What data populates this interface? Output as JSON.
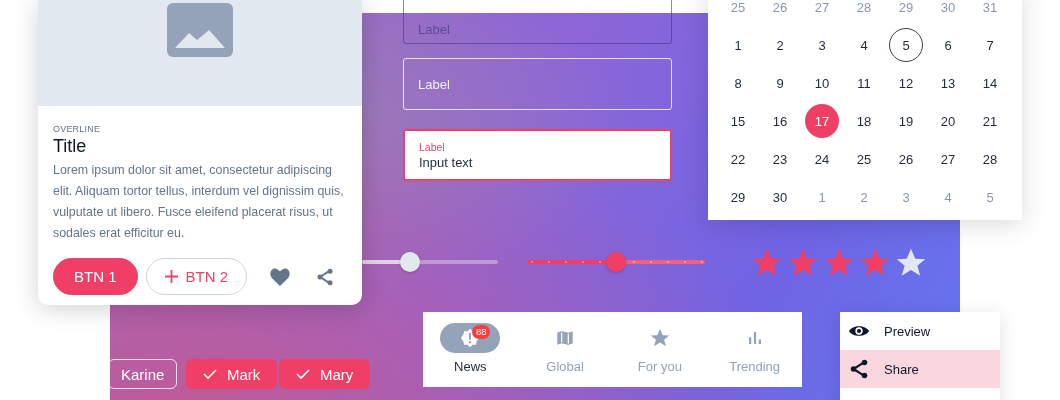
{
  "card": {
    "overline": "OVERLINE",
    "title": "Title",
    "body": "Lorem ipsum dolor sit amet, consectetur adipiscing elit. Aliquam tortor tellus, interdum vel dignissim quis, vulputate ut libero. Fusce eleifend placerat risus, ut sodales erat efficitur eu.",
    "buttons": [
      {
        "label": "BTN 1",
        "kind": "filled"
      },
      {
        "label": "BTN 2",
        "kind": "outlined"
      }
    ]
  },
  "text_fields": [
    {
      "kind": "dim",
      "label": "Label"
    },
    {
      "kind": "outlined",
      "label": "Label"
    },
    {
      "kind": "active",
      "label": "Label",
      "value": "Input text"
    }
  ],
  "calendar": {
    "days": [
      {
        "label": "25",
        "kind": "outside",
        "selected": false,
        "today": false
      },
      {
        "label": "26",
        "kind": "outside",
        "selected": false,
        "today": false
      },
      {
        "label": "27",
        "kind": "outside",
        "selected": false,
        "today": false
      },
      {
        "label": "28",
        "kind": "outside",
        "selected": false,
        "today": false
      },
      {
        "label": "29",
        "kind": "outside",
        "selected": false,
        "today": false
      },
      {
        "label": "30",
        "kind": "outside",
        "selected": false,
        "today": false
      },
      {
        "label": "31",
        "kind": "outside",
        "selected": false,
        "today": false
      },
      {
        "label": "1",
        "kind": "day",
        "selected": false,
        "today": false
      },
      {
        "label": "2",
        "kind": "day",
        "selected": false,
        "today": false
      },
      {
        "label": "3",
        "kind": "day",
        "selected": false,
        "today": false
      },
      {
        "label": "4",
        "kind": "day",
        "selected": false,
        "today": false
      },
      {
        "label": "5",
        "kind": "day",
        "selected": false,
        "today": true
      },
      {
        "label": "6",
        "kind": "day",
        "selected": false,
        "today": false
      },
      {
        "label": "7",
        "kind": "day",
        "selected": false,
        "today": false
      },
      {
        "label": "8",
        "kind": "day",
        "selected": false,
        "today": false
      },
      {
        "label": "9",
        "kind": "day",
        "selected": false,
        "today": false
      },
      {
        "label": "10",
        "kind": "day",
        "selected": false,
        "today": false
      },
      {
        "label": "11",
        "kind": "day",
        "selected": false,
        "today": false
      },
      {
        "label": "12",
        "kind": "day",
        "selected": false,
        "today": false
      },
      {
        "label": "13",
        "kind": "day",
        "selected": false,
        "today": false
      },
      {
        "label": "14",
        "kind": "day",
        "selected": false,
        "today": false
      },
      {
        "label": "15",
        "kind": "day",
        "selected": false,
        "today": false
      },
      {
        "label": "16",
        "kind": "day",
        "selected": false,
        "today": false
      },
      {
        "label": "17",
        "kind": "day",
        "selected": true,
        "today": false
      },
      {
        "label": "18",
        "kind": "day",
        "selected": false,
        "today": false
      },
      {
        "label": "19",
        "kind": "day",
        "selected": false,
        "today": false
      },
      {
        "label": "20",
        "kind": "day",
        "selected": false,
        "today": false
      },
      {
        "label": "21",
        "kind": "day",
        "selected": false,
        "today": false
      },
      {
        "label": "22",
        "kind": "day",
        "selected": false,
        "today": false
      },
      {
        "label": "23",
        "kind": "day",
        "selected": false,
        "today": false
      },
      {
        "label": "24",
        "kind": "day",
        "selected": false,
        "today": false
      },
      {
        "label": "25",
        "kind": "day",
        "selected": false,
        "today": false
      },
      {
        "label": "26",
        "kind": "day",
        "selected": false,
        "today": false
      },
      {
        "label": "27",
        "kind": "day",
        "selected": false,
        "today": false
      },
      {
        "label": "28",
        "kind": "day",
        "selected": false,
        "today": false
      },
      {
        "label": "29",
        "kind": "day",
        "selected": false,
        "today": false
      },
      {
        "label": "30",
        "kind": "day",
        "selected": false,
        "today": false
      },
      {
        "label": "1",
        "kind": "outside",
        "selected": false,
        "today": false
      },
      {
        "label": "2",
        "kind": "outside",
        "selected": false,
        "today": false
      },
      {
        "label": "3",
        "kind": "outside",
        "selected": false,
        "today": false
      },
      {
        "label": "4",
        "kind": "outside",
        "selected": false,
        "today": false
      },
      {
        "label": "5",
        "kind": "outside",
        "selected": false,
        "today": false
      }
    ]
  },
  "sliders": [
    {
      "kind": "plain",
      "level": 0.35
    },
    {
      "kind": "stepped",
      "level": 0.5
    }
  ],
  "rating": {
    "stars": 4
  },
  "chips": [
    {
      "label": "Karine",
      "selected": false
    },
    {
      "label": "Mark",
      "selected": true
    },
    {
      "label": "Mary",
      "selected": true
    }
  ],
  "bottom_nav": [
    {
      "label": "News",
      "selected": true,
      "badge": "88"
    },
    {
      "label": "Global",
      "selected": false
    },
    {
      "label": "For you",
      "selected": false
    },
    {
      "label": "Trending",
      "selected": false
    }
  ],
  "menu": [
    {
      "label": "Preview",
      "selected": false
    },
    {
      "label": "Share",
      "selected": true
    }
  ]
}
